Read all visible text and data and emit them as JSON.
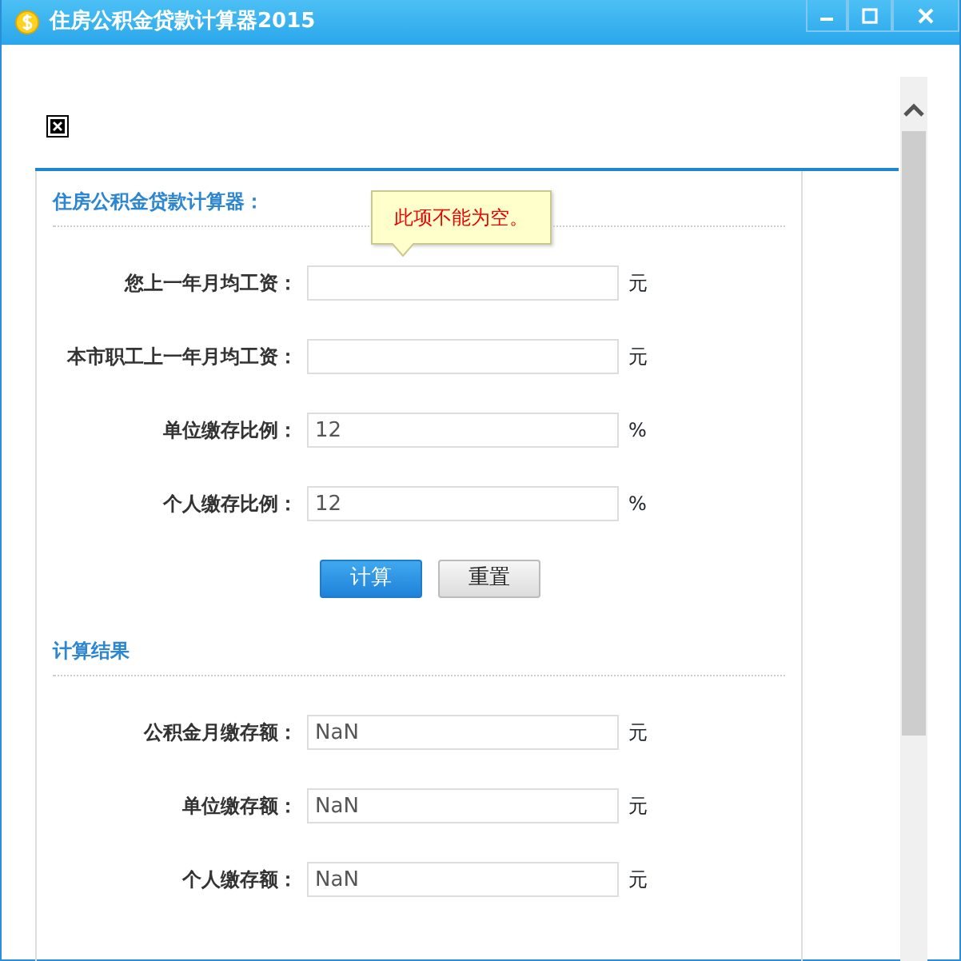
{
  "window": {
    "title": "住房公积金贷款计算器2015"
  },
  "form": {
    "title": "住房公积金贷款计算器：",
    "fields": [
      {
        "label": "您上一年月均工资：",
        "unit": "元"
      },
      {
        "label": "本市职工上一年月均工资：",
        "unit": "元"
      },
      {
        "label": "单位缴存比例：",
        "value": "12",
        "unit": "%"
      },
      {
        "label": "个人缴存比例：",
        "value": "12",
        "unit": "%"
      }
    ]
  },
  "tooltip": {
    "text": "此项不能为空。"
  },
  "buttons": [
    {
      "label": "计算",
      "kind": "primary"
    },
    {
      "label": "重置",
      "kind": "secondary"
    }
  ],
  "results": {
    "title": "计算结果",
    "fields": [
      {
        "label": "公积金月缴存额：",
        "value": "NaN",
        "unit": "元"
      },
      {
        "label": "单位缴存额：",
        "value": "NaN",
        "unit": "元"
      },
      {
        "label": "个人缴存额：",
        "value": "NaN",
        "unit": "元"
      }
    ]
  }
}
